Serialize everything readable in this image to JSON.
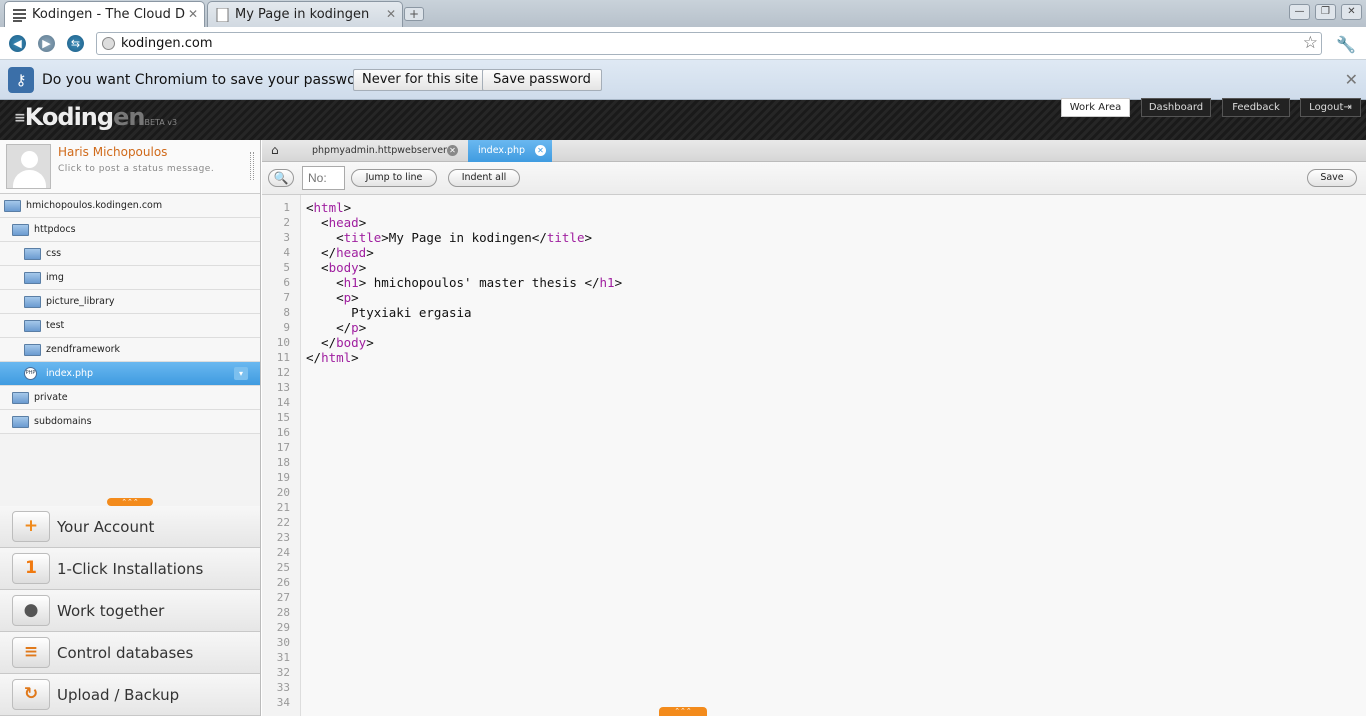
{
  "browser": {
    "tabs": [
      {
        "title": "Kodingen - The Cloud D",
        "active": true
      },
      {
        "title": "My Page in kodingen",
        "active": false
      }
    ],
    "url": "kodingen.com",
    "password_bar": {
      "question": "Do you want Chromium to save your password?",
      "never_label": "Never for this site",
      "save_label": "Save password"
    }
  },
  "header": {
    "logo_main": "Koding",
    "logo_en": "en",
    "logo_beta": "BETA v3",
    "nav": [
      "Work Area",
      "Dashboard",
      "Feedback",
      "Logout"
    ]
  },
  "profile": {
    "name": "Haris Michopoulos",
    "status": "Click to post a status message."
  },
  "tree": [
    {
      "label": "hmichopoulos.kodingen.com",
      "type": "folder",
      "indent": 0
    },
    {
      "label": "httpdocs",
      "type": "folder",
      "indent": 1
    },
    {
      "label": "css",
      "type": "folder",
      "indent": 2
    },
    {
      "label": "img",
      "type": "folder",
      "indent": 2
    },
    {
      "label": "picture_library",
      "type": "folder",
      "indent": 2
    },
    {
      "label": "test",
      "type": "folder",
      "indent": 2
    },
    {
      "label": "zendframework",
      "type": "folder",
      "indent": 2
    },
    {
      "label": "index.php",
      "type": "file",
      "indent": 2,
      "selected": true,
      "file_icon": "PHP"
    },
    {
      "label": "private",
      "type": "folder",
      "indent": 1
    },
    {
      "label": "subdomains",
      "type": "folder",
      "indent": 1
    }
  ],
  "menu": [
    {
      "label": "Your Account",
      "icon": "+",
      "icon_color": "#f08a1c"
    },
    {
      "label": "1-Click Installations",
      "icon": "1",
      "icon_color": "#f07a10"
    },
    {
      "label": "Work together",
      "icon": "●",
      "icon_color": "#555555"
    },
    {
      "label": "Control databases",
      "icon": "≡",
      "icon_color": "#e0791b"
    },
    {
      "label": "Upload / Backup",
      "icon": "↻",
      "icon_color": "#e0791b"
    }
  ],
  "editor": {
    "tabs": [
      {
        "label": "phpmyadmin.httpwebserver",
        "active": false
      },
      {
        "label": "index.php",
        "active": true
      }
    ],
    "line_placeholder": "No:",
    "jump_label": "Jump to line",
    "indent_label": "Indent all",
    "save_label": "Save",
    "code_lines": [
      "<html>",
      "  <head>",
      "    <title>My Page in kodingen</title>",
      "  </head>",
      "  <body>",
      "    <h1> hmichopoulos' master thesis </h1>",
      "    <p>",
      "      Ptyxiaki ergasia",
      "    </p>",
      "  </body>",
      "</html>"
    ],
    "line_count": 34
  },
  "colors": {
    "accent_orange": "#f38b1c",
    "selection_blue": "#3f9be0",
    "tag_purple": "#a020a0",
    "username_orange": "#d06a1a"
  }
}
